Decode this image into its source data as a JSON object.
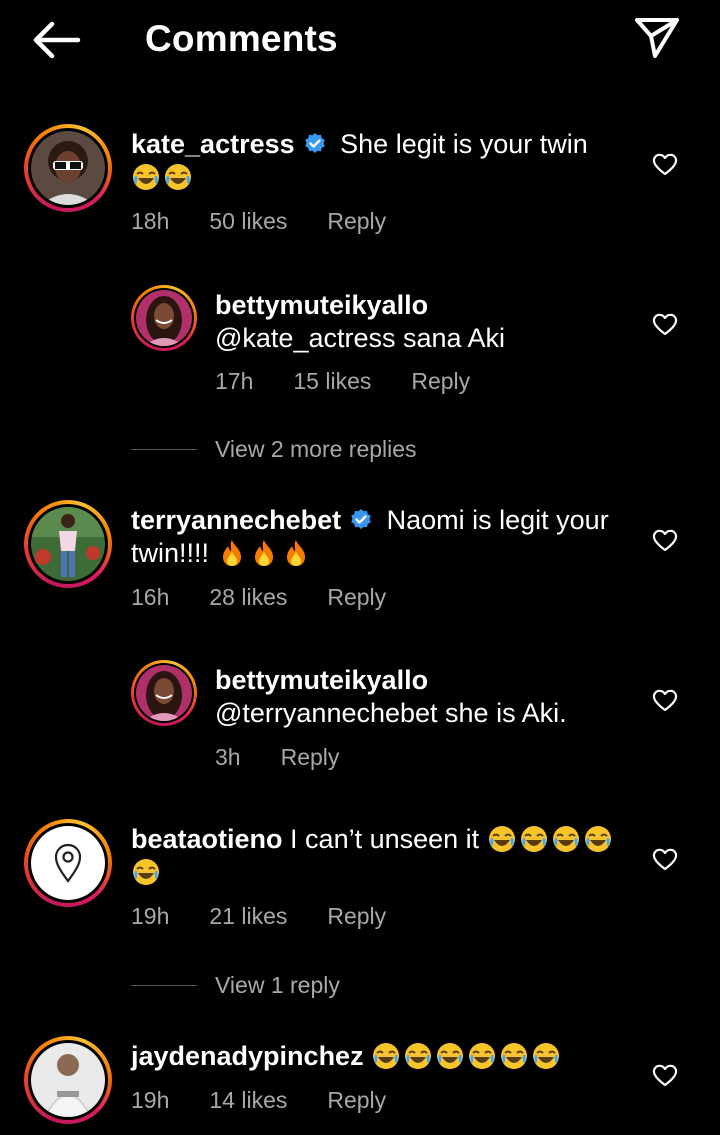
{
  "header": {
    "title": "Comments"
  },
  "comments": [
    {
      "username": "kate_actress",
      "verified": true,
      "text": "She legit is your twin",
      "emojis": 2,
      "time": "18h",
      "likes": "50 likes",
      "reply": "Reply"
    },
    {
      "username": "bettymuteikyallo",
      "verified": false,
      "text": "@kate_actress sana Aki",
      "time": "17h",
      "likes": "15 likes",
      "reply": "Reply"
    },
    {
      "username": "terryannechebet",
      "verified": true,
      "text": "Naomi is legit your twin!!!!",
      "emojis": 3,
      "time": "16h",
      "likes": "28 likes",
      "reply": "Reply"
    },
    {
      "username": "bettymuteikyallo",
      "verified": false,
      "text": "@terryannechebet she is Aki.",
      "time": "3h",
      "reply": "Reply"
    },
    {
      "username": "beataotieno",
      "verified": false,
      "text": "I can’t unseen it",
      "emojis": 5,
      "time": "19h",
      "likes": "21 likes",
      "reply": "Reply"
    },
    {
      "username": "jaydenadypinchez",
      "verified": false,
      "emojis": 6,
      "time": "19h",
      "likes": "14 likes",
      "reply": "Reply"
    }
  ],
  "view_more": [
    "View 2 more replies",
    "View 1 reply"
  ],
  "icons": {
    "verified": "verified-badge-icon",
    "like": "heart-icon",
    "back": "back-arrow-icon",
    "send": "send-icon",
    "location": "location-pin-icon"
  },
  "colors": {
    "verified": "#3897f0",
    "secondary": "#a8a8a8"
  }
}
